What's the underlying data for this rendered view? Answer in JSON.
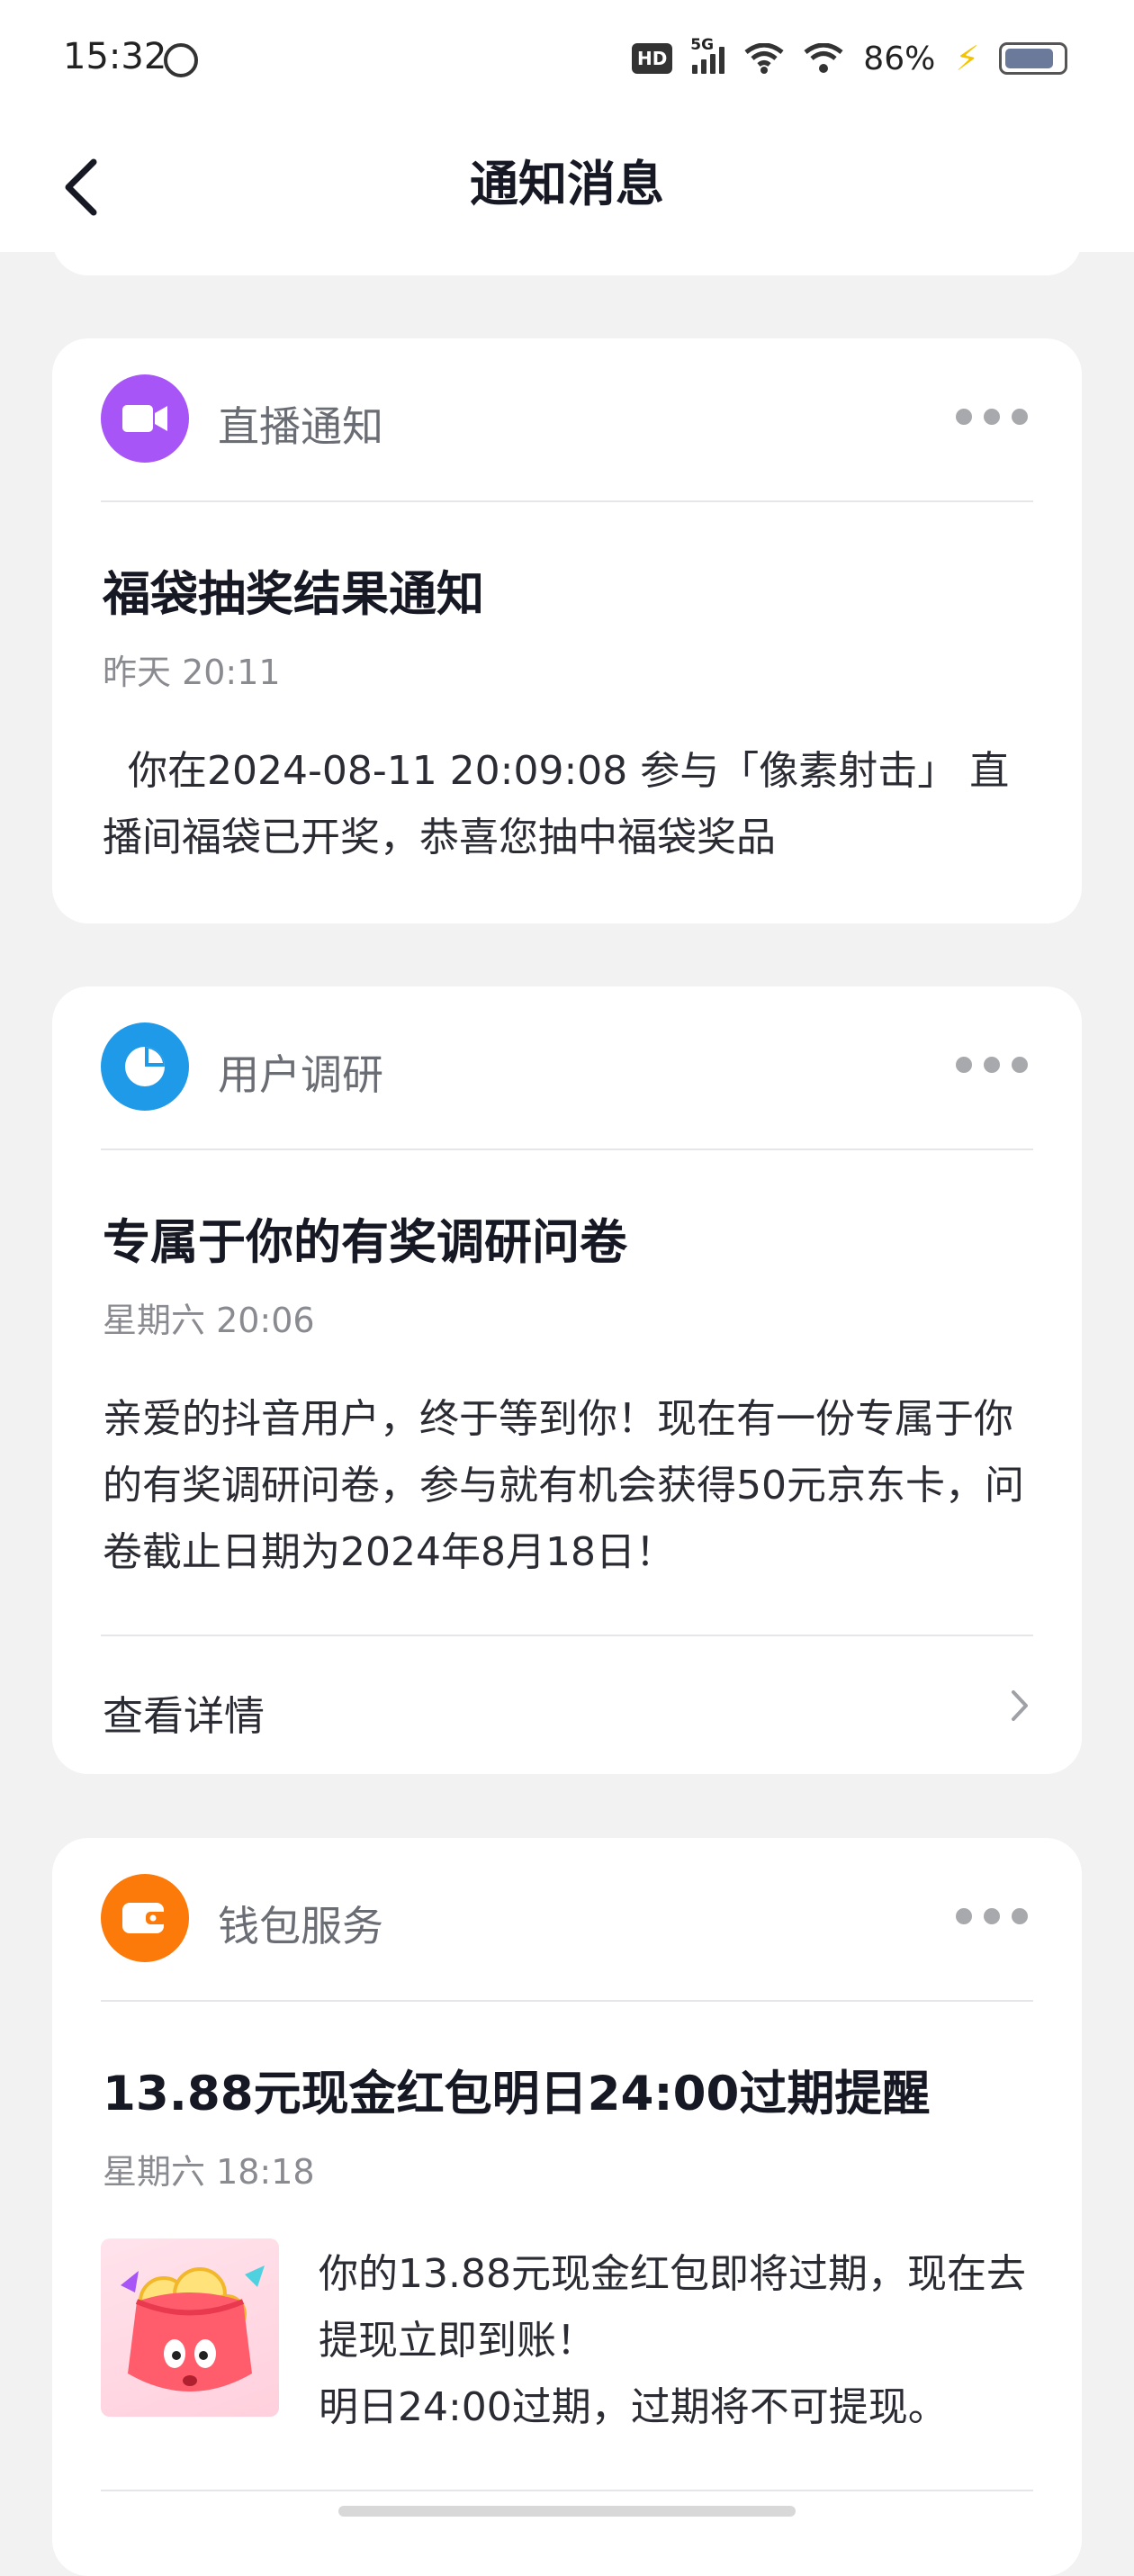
{
  "status_bar": {
    "time": "15:32",
    "hd": "HD",
    "network": "5G",
    "battery": "86%"
  },
  "header": {
    "title": "通知消息"
  },
  "cards": [
    {
      "category": "直播通知",
      "icon": "video-camera-icon",
      "icon_color": "#a855f7",
      "title": "福袋抽奖结果通知",
      "time": "昨天 20:11",
      "body": "  你在2024-08-11 20:09:08 参与「像素射击」 直播间福袋已开奖，恭喜您抽中福袋奖品"
    },
    {
      "category": "用户调研",
      "icon": "pie-chart-icon",
      "icon_color": "#1f9ae8",
      "title": "专属于你的有奖调研问卷",
      "time": "星期六 20:06",
      "body": "亲爱的抖音用户，终于等到你！现在有一份专属于你的有奖调研问卷，参与就有机会获得50元京东卡，问卷截止日期为2024年8月18日！",
      "action": "查看详情"
    },
    {
      "category": "钱包服务",
      "icon": "wallet-icon",
      "icon_color": "#fb7a0a",
      "title": "13.88元现金红包明日24:00过期提醒",
      "time": "星期六 18:18",
      "body_line1": "你的13.88元现金红包即将过期，现在去提现立即到账！",
      "body_line2": "明日24:00过期，过期将不可提现。"
    }
  ]
}
